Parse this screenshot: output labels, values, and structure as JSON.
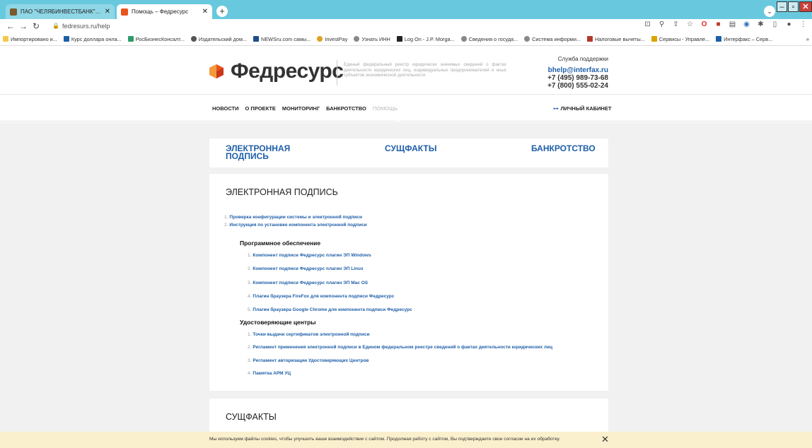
{
  "browser": {
    "tabs": [
      {
        "title": "ПАО \"ЧЕЛЯБИНВЕСТБАНК\", Бан",
        "active": false,
        "favicon_color": "#7a5a2a"
      },
      {
        "title": "Помощь – Федресурс",
        "active": true,
        "favicon_color": "#e8541d"
      }
    ],
    "url": "fedresurs.ru/help",
    "bookmarks": [
      {
        "label": "Импортировано и...",
        "color": "#f2c94c"
      },
      {
        "label": "Курс доллара онла...",
        "color": "#1c5fa8"
      },
      {
        "label": "РосБизнесКонсалт...",
        "color": "#2d9c6a"
      },
      {
        "label": "Издательский дом...",
        "color": "#555555"
      },
      {
        "label": "NEWSru.com самы...",
        "color": "#1d4f8a"
      },
      {
        "label": "InvestPay",
        "color": "#e0a020"
      },
      {
        "label": "Узнать ИНН",
        "color": "#888888"
      },
      {
        "label": "Log On - J.P. Morga...",
        "color": "#222222"
      },
      {
        "label": "Сведения о госуда...",
        "color": "#888888"
      },
      {
        "label": "Система информи...",
        "color": "#888888"
      },
      {
        "label": "Налоговые вычеты...",
        "color": "#b4382a"
      },
      {
        "label": "Сервисы - Управле...",
        "color": "#d9a400"
      },
      {
        "label": "Интерфакс – Серв...",
        "color": "#1c5fa8"
      }
    ]
  },
  "site": {
    "logo_text": "Федресурс",
    "logo_desc": "Единый федеральный реестр юридически значимых сведений о фактах деятельности юридических лиц, индивидуальных предпринимателей и иных субъектов экономической деятельности",
    "support_title": "Служба поддержки",
    "support_email": "bhelp@interfax.ru",
    "support_phone_1": "+7 (495) 989-73-68",
    "support_phone_2": "+7 (800) 555-02-24",
    "nav": [
      "НОВОСТИ",
      "О ПРОЕКТЕ",
      "МОНИТОРИНГ",
      "БАНКРОТСТВО",
      "ПОМОЩЬ"
    ],
    "nav_active": "ПОМОЩЬ",
    "cabinet_label": "ЛИЧНЫЙ КАБИНЕТ"
  },
  "help_tabs": {
    "ep_line1": "ЭЛЕКТРОННАЯ",
    "ep_line2": "ПОДПИСЬ",
    "facts": "СУЩФАКТЫ",
    "bankruptcy": "БАНКРОТСТВО"
  },
  "ep_section": {
    "title": "ЭЛЕКТРОННАЯ ПОДПИСЬ",
    "items": [
      {
        "num": "1.",
        "label": "Проверка конфигурации системы и электронной подписи"
      },
      {
        "num": "2.",
        "label": "Инструкция по установке компонента электронной подписи"
      }
    ],
    "software_title": "Программное обеспечение",
    "software_items": [
      {
        "num": "1.",
        "label": "Компонент подписи Федресурс плагин ЭП Windows"
      },
      {
        "num": "2.",
        "label": "Компонент подписи Федресурс плагин ЭП Linux"
      },
      {
        "num": "3.",
        "label": "Компонент подписи Федресурс плагин ЭП Mac OS"
      },
      {
        "num": "4.",
        "label": "Плагин браузера FireFox для компонента подписи Федресурс"
      },
      {
        "num": "5.",
        "label": "Плагин браузера Google Chrome для компонента подписи Федресурс"
      }
    ],
    "ca_title": "Удостоверяющие центры",
    "ca_items": [
      {
        "num": "1.",
        "label": "Точки выдачи сертификатов электронной подписи"
      },
      {
        "num": "2.",
        "label": "Регламент применения электронной подписи в Едином федеральном реестре сведений о фактах деятельности юридических лиц"
      },
      {
        "num": "3.",
        "label": "Регламент авторизации Удостоверяющих Центров"
      },
      {
        "num": "4.",
        "label": "Памятка АРМ УЦ"
      }
    ]
  },
  "facts_section": {
    "title": "СУЩФАКТЫ"
  },
  "cookie": {
    "text": "Мы используем файлы cookies, чтобы улучшить ваше взаимодействие с сайтом. Продолжая работу с сайтом, Вы подтверждаете свое согласие на их обработку.",
    "close": "✕"
  },
  "colors": {
    "brand_blue": "#1f5fa8",
    "logo_orange": "#e8541d",
    "tab_strip": "#68c9de",
    "cookie_bg": "#fbf0cd"
  }
}
